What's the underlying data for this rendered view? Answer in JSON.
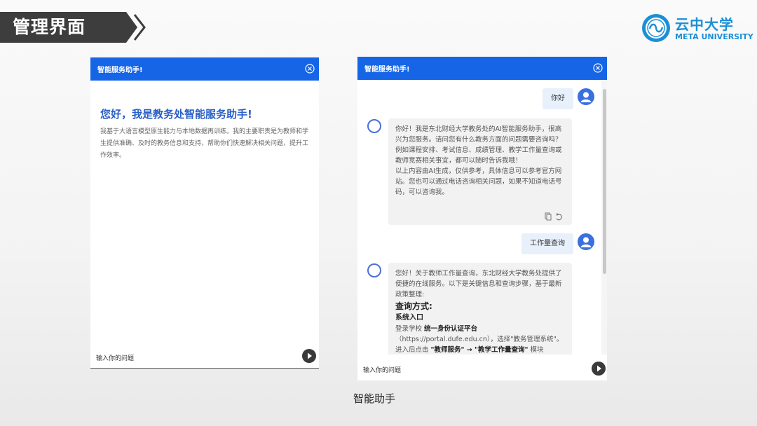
{
  "slide": {
    "title": "管理界面",
    "caption": "智能助手",
    "logo": {
      "name_cn": "云中大学",
      "name_en": "META UNIVERSITY"
    }
  },
  "colors": {
    "header_blue": "#1565e6",
    "title_blue": "#2a5fc7",
    "banner_dark": "#3d3d3d",
    "logo_blue": "#1a8fd6",
    "user_bubble": "#e8f0fb",
    "bot_bubble": "#f2f2f2"
  },
  "left_panel": {
    "header_title": "智能服务助手!",
    "welcome_title": "您好，我是教务处智能服务助手!",
    "welcome_text": "我基于大语言模型原生能力与本地数据再训练。我的主要职责是为教师和学生提供准确、及时的教务信息和支持，帮助你们快速解决相关问题，提升工作效率。",
    "input_placeholder": "输入你的问题"
  },
  "right_panel": {
    "header_title": "智能服务助手!",
    "input_placeholder": "输入你的问题",
    "messages": [
      {
        "role": "user",
        "text": "你好"
      },
      {
        "role": "bot",
        "lines": [
          "你好！我是东北财经大学教务处的AI智能服务助手，很高兴为您服务。请问您有什么教务方面的问题需要咨询吗？例如课程安排、考试信息、成绩管理、教学工作量查询或教师竞赛相关事宜，都可以随时告诉我哦！",
          "以上内容由AI生成，仅供参考，具体信息可以参考官方网站。您也可以通过电话咨询相关问题，如果不知道电话号码，可以咨询我。"
        ]
      },
      {
        "role": "user",
        "text": "工作量查询"
      },
      {
        "role": "bot",
        "intro": "您好！关于教师工作量查询，东北财经大学教务处提供了便捷的在线服务。以下是关键信息和查询步骤，基于最新政策整理:",
        "heading": "查询方式:",
        "subheading": "系统入口",
        "line1_prefix": "登录学校 ",
        "line1_bold": "统一身份认证平台",
        "line1_suffix": "（https://portal.dufe.edu.cn），选择\"教务管理系统\"。",
        "line2_prefix": "进入后点击 ",
        "line2_bold1": "\"教师服务\"",
        "line2_arrow": " → ",
        "line2_bold2": "\"教学工作量查询\"",
        "line2_suffix": " 模块"
      }
    ]
  },
  "icons": {
    "close": "close-circle-icon",
    "send": "send-arrow-icon",
    "user_avatar": "user-avatar-icon",
    "bot_avatar": "bot-avatar-icon",
    "copy": "copy-icon",
    "regenerate": "regenerate-icon"
  }
}
